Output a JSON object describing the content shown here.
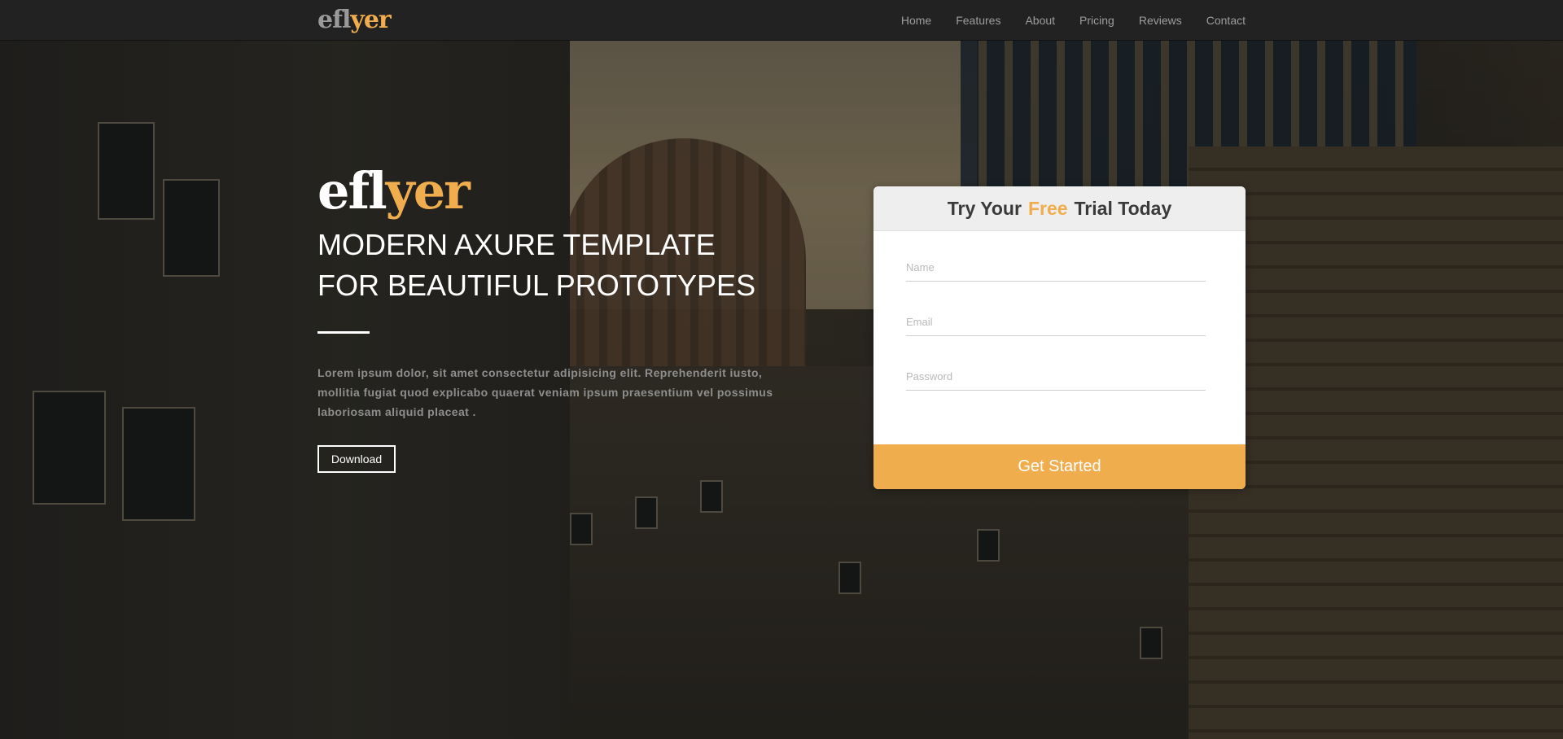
{
  "nav": {
    "brand": {
      "part1": "efl",
      "part2": "yer"
    },
    "items": [
      "Home",
      "Features",
      "About",
      "Pricing",
      "Reviews",
      "Contact"
    ]
  },
  "hero": {
    "title": {
      "part1": "efl",
      "part2": "yer"
    },
    "subtitle_line1": "MODERN AXURE TEMPLATE",
    "subtitle_line2": "FOR BEAUTIFUL PROTOTYPES",
    "body": "Lorem ipsum dolor, sit amet consectetur adipisicing elit. Reprehenderit iusto, mollitia fugiat quod explicabo quaerat veniam ipsum praesentium vel possimus laboriosam aliquid placeat .",
    "download_label": "Download"
  },
  "trial": {
    "heading_pre": "Try Your",
    "heading_free": "Free",
    "heading_post": "Trial Today",
    "name_placeholder": "Name",
    "email_placeholder": "Email",
    "password_placeholder": "Password",
    "submit_label": "Get Started"
  },
  "colors": {
    "accent": "#f0ad4e",
    "navbar": "#222222",
    "nav_text": "#9d9d9d",
    "card_header": "#eeeeee"
  }
}
